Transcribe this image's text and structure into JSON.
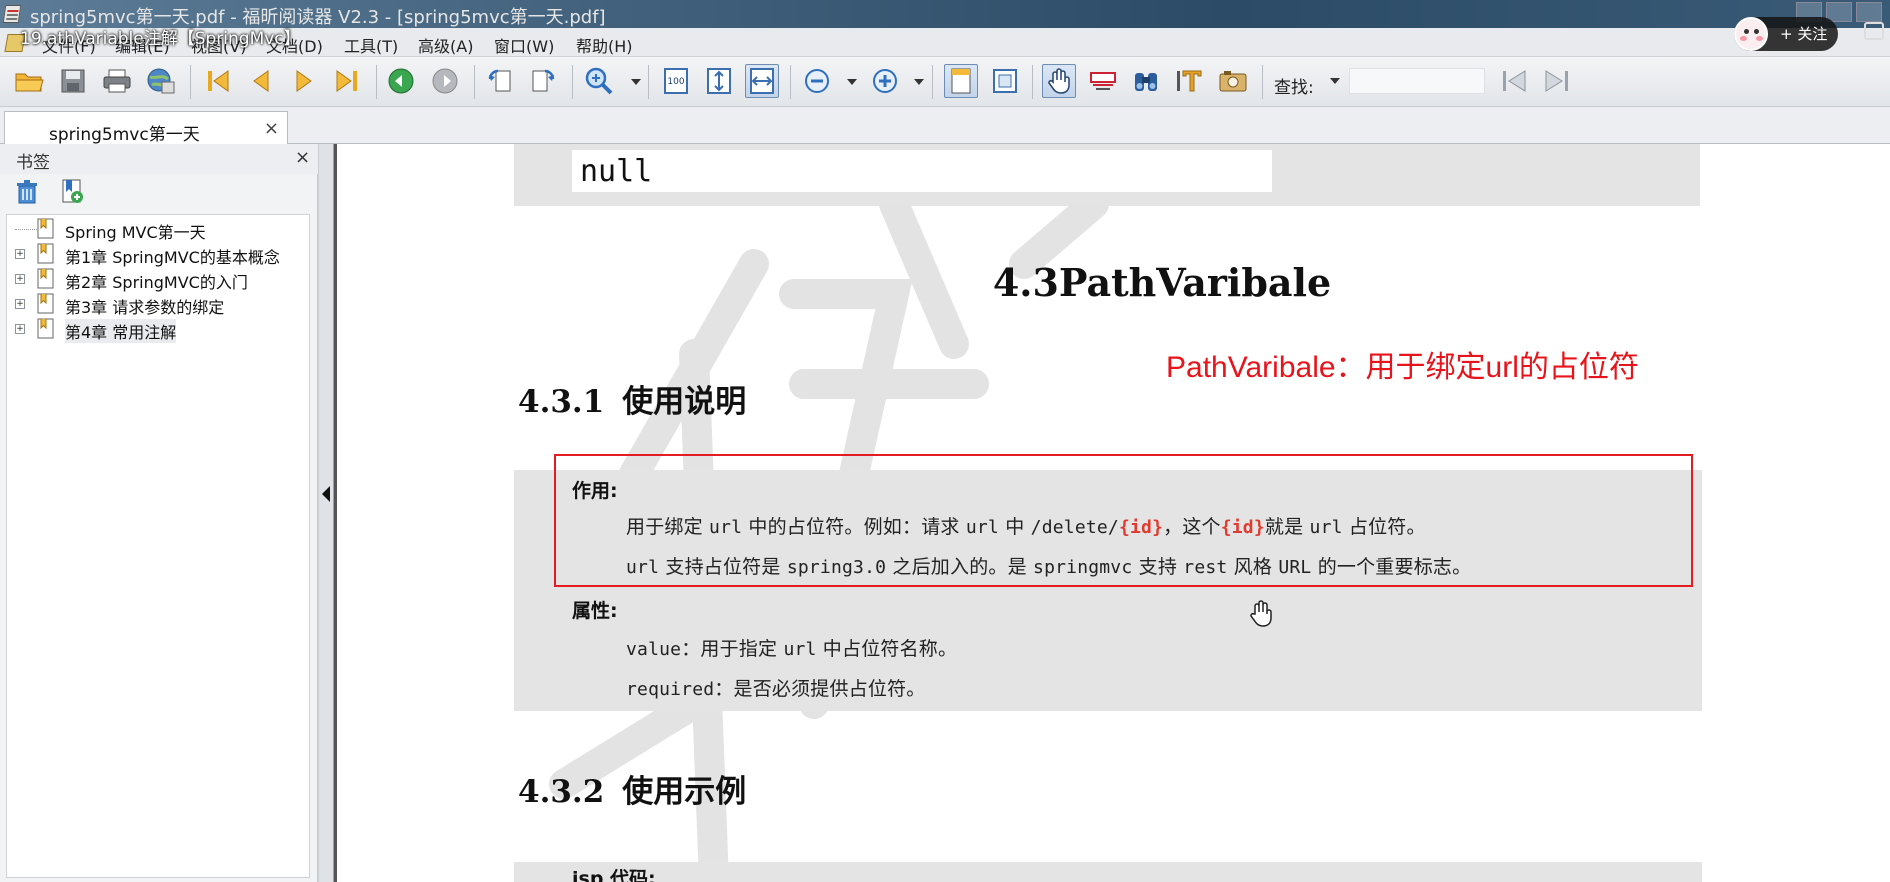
{
  "window": {
    "title": "spring5mvc第一天.pdf - 福昕阅读器 V2.3 - [spring5mvc第一天.pdf]"
  },
  "video_overlay": {
    "title": "19.athVariable注解【SpringMvc】",
    "follow_label": "+ 关注"
  },
  "menu": {
    "items": [
      "文件(F)",
      "编辑(E)",
      "视图(V)",
      "文档(D)",
      "工具(T)",
      "高级(A)",
      "窗口(W)",
      "帮助(H)"
    ]
  },
  "toolbar": {
    "zoom_actual_size_label": "100",
    "find_label": "查找:",
    "find_value": ""
  },
  "tabs": {
    "document_tab": "spring5mvc第一天",
    "close_glyph": "×"
  },
  "sidebar": {
    "title": "书签",
    "close_glyph": "×",
    "bookmarks": [
      {
        "label": "Spring MVC第一天",
        "expandable": false
      },
      {
        "label": "第1章 SpringMVC的基本概念",
        "expandable": true
      },
      {
        "label": "第2章 SpringMVC的入门",
        "expandable": true
      },
      {
        "label": "第3章 请求参数的绑定",
        "expandable": true
      },
      {
        "label": "第4章 常用注解",
        "expandable": true,
        "selected": true
      }
    ]
  },
  "document": {
    "code_snippet": "null",
    "section_title": "4.3PathVaribale",
    "annotation": "PathVaribale：用于绑定url的占位符",
    "h_usage_num": "4.3.1",
    "h_usage_txt": "使用说明",
    "usage": {
      "purpose_heading": "作用:",
      "line1_a": "用于绑定 ",
      "line1_b": "url",
      "line1_c": " 中的占位符。例如：请求 ",
      "line1_d": "url",
      "line1_e": " 中 ",
      "line1_f": "/delete/",
      "line1_g": "{id}",
      "line1_h": "，这个",
      "line1_i": "{id}",
      "line1_j": "就是 ",
      "line1_k": "url",
      "line1_l": " 占位符。",
      "line2_a": "url",
      "line2_b": " 支持占位符是 ",
      "line2_c": "spring3.0",
      "line2_d": " 之后加入的。是 ",
      "line2_e": "springmvc",
      "line2_f": " 支持 ",
      "line2_g": "rest",
      "line2_h": " 风格 ",
      "line2_i": "URL",
      "line2_j": " 的一个重要标志。",
      "attrs_heading": "属性:",
      "attr1_a": "value",
      "attr1_b": "：用于指定 ",
      "attr1_c": "url",
      "attr1_d": " 中占位符名称。",
      "attr2_a": "required",
      "attr2_b": "：是否必须提供占位符。"
    },
    "h_example_num": "4.3.2",
    "h_example_txt": "使用示例",
    "jsp_label": "jsp 代码:"
  },
  "colors": {
    "annotation_red": "#e8141b",
    "highlight_border": "#e31b23",
    "code_highlight": "#e23a2e",
    "box_gray": "#e4e4e4"
  },
  "icons": [
    "open-folder-icon",
    "save-icon",
    "print-icon",
    "web-icon",
    "first-page-icon",
    "prev-page-icon",
    "next-page-icon",
    "last-page-icon",
    "back-icon",
    "forward-icon",
    "rotate-left-icon",
    "rotate-right-icon",
    "zoom-icon",
    "actual-size-icon",
    "fit-page-icon",
    "fit-width-icon",
    "zoom-out-icon",
    "zoom-in-icon",
    "single-page-icon",
    "continuous-icon",
    "hand-tool-icon",
    "select-tool-icon",
    "binoculars-icon",
    "text-tool-icon",
    "snapshot-icon",
    "find-prev-icon",
    "find-next-icon"
  ]
}
